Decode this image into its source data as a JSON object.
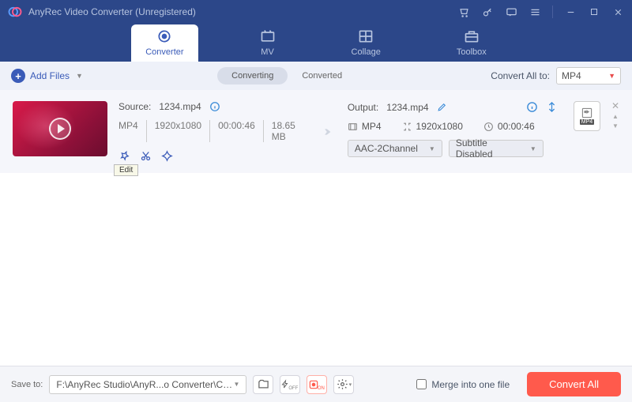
{
  "titlebar": {
    "title": "AnyRec Video Converter (Unregistered)"
  },
  "nav": {
    "converter": "Converter",
    "mv": "MV",
    "collage": "Collage",
    "toolbox": "Toolbox"
  },
  "toolbar": {
    "add_files": "Add Files",
    "converting": "Converting",
    "converted": "Converted",
    "convert_all_to": "Convert All to:",
    "format": "MP4"
  },
  "item": {
    "source_label": "Source:",
    "source_file": "1234.mp4",
    "src_format": "MP4",
    "src_res": "1920x1080",
    "src_dur": "00:00:46",
    "src_size": "18.65 MB",
    "edit_tooltip": "Edit",
    "output_label": "Output:",
    "output_file": "1234.mp4",
    "out_format": "MP4",
    "out_res": "1920x1080",
    "out_dur": "00:00:46",
    "audio_sel": "AAC-2Channel",
    "subtitle_sel": "Subtitle Disabled",
    "fmt_badge": "MP4"
  },
  "footer": {
    "save_to_label": "Save to:",
    "path": "F:\\AnyRec Studio\\AnyR...o Converter\\Converted",
    "merge_label": "Merge into one file",
    "convert_all_btn": "Convert All"
  }
}
